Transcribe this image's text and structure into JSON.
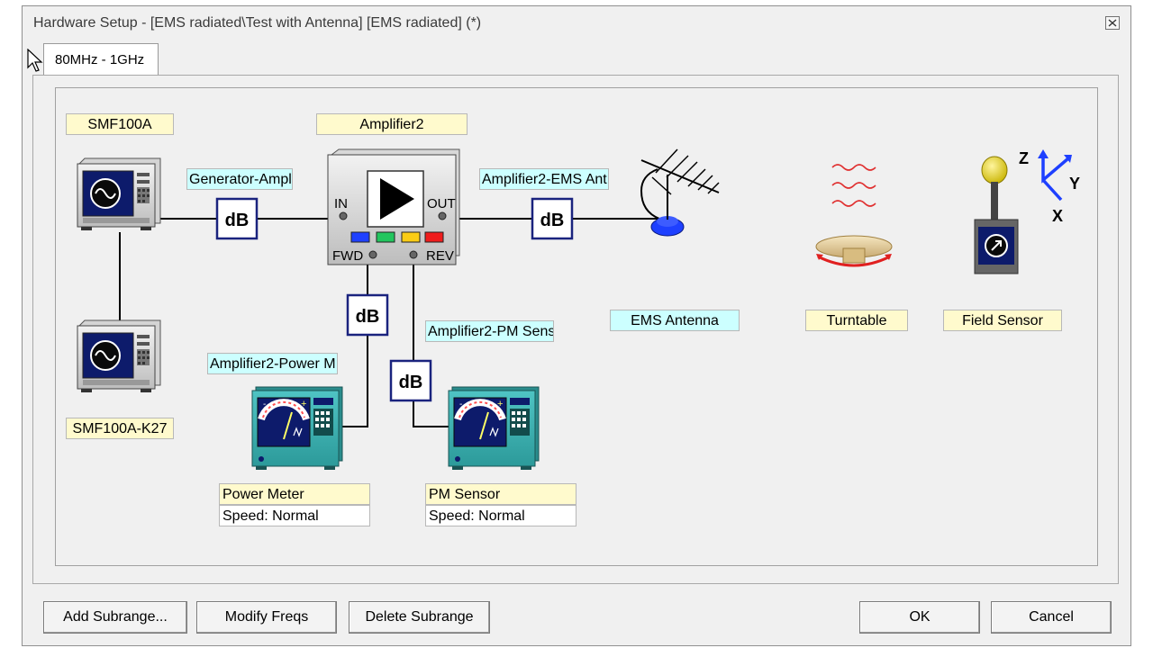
{
  "window": {
    "title": "Hardware Setup  -  [EMS radiated\\Test with Antenna] [EMS radiated] (*)"
  },
  "tabs": [
    {
      "label": "80MHz - 1GHz"
    }
  ],
  "diagram": {
    "devices": {
      "generator": {
        "label": "SMF100A"
      },
      "generator2": {
        "label": "SMF100A-K27"
      },
      "amplifier": {
        "label": "Amplifier2",
        "in": "IN",
        "out": "OUT",
        "fwd": "FWD",
        "rev": "REV"
      },
      "antenna": {
        "label": "EMS Antenna"
      },
      "turntable": {
        "label": "Turntable"
      },
      "field_sensor": {
        "label": "Field Sensor",
        "axis_x": "X",
        "axis_y": "Y",
        "axis_z": "Z"
      },
      "power_meter": {
        "label": "Power Meter",
        "speed": "Speed: Normal"
      },
      "pm_sensor": {
        "label": "PM Sensor",
        "speed": "Speed: Normal"
      }
    },
    "connections": {
      "gen_amp": {
        "label": "Generator-Ampli"
      },
      "amp_ant": {
        "label": "Amplifier2-EMS Ant"
      },
      "amp_pm_sens": {
        "label": "Amplifier2-PM Sens"
      },
      "amp_power": {
        "label": "Amplifier2-Power M"
      }
    },
    "db_symbol": "dB",
    "colors": {
      "label_yellow": "#fffacd",
      "label_cyan": "#ccffff",
      "db_border": "#1a237e",
      "led_blue": "#1e40ff",
      "led_green": "#22c55e",
      "led_yellow": "#facc15",
      "led_red": "#ef1c1c"
    }
  },
  "buttons": {
    "add_subrange": "Add Subrange...",
    "modify_freqs": "Modify Freqs",
    "delete_subrange": "Delete Subrange",
    "ok": "OK",
    "cancel": "Cancel"
  }
}
